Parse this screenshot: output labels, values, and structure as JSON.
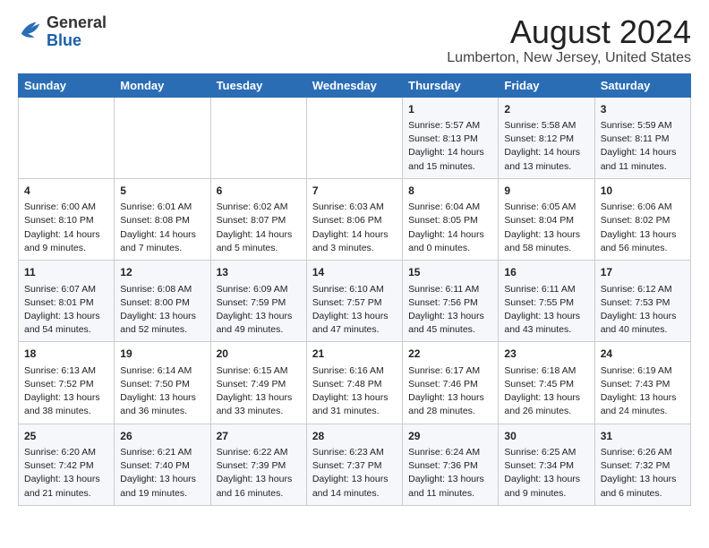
{
  "header": {
    "logo_line1": "General",
    "logo_line2": "Blue",
    "month_title": "August 2024",
    "location": "Lumberton, New Jersey, United States"
  },
  "calendar": {
    "days_of_week": [
      "Sunday",
      "Monday",
      "Tuesday",
      "Wednesday",
      "Thursday",
      "Friday",
      "Saturday"
    ],
    "weeks": [
      [
        {
          "day": "",
          "content": ""
        },
        {
          "day": "",
          "content": ""
        },
        {
          "day": "",
          "content": ""
        },
        {
          "day": "",
          "content": ""
        },
        {
          "day": "1",
          "content": "Sunrise: 5:57 AM\nSunset: 8:13 PM\nDaylight: 14 hours\nand 15 minutes."
        },
        {
          "day": "2",
          "content": "Sunrise: 5:58 AM\nSunset: 8:12 PM\nDaylight: 14 hours\nand 13 minutes."
        },
        {
          "day": "3",
          "content": "Sunrise: 5:59 AM\nSunset: 8:11 PM\nDaylight: 14 hours\nand 11 minutes."
        }
      ],
      [
        {
          "day": "4",
          "content": "Sunrise: 6:00 AM\nSunset: 8:10 PM\nDaylight: 14 hours\nand 9 minutes."
        },
        {
          "day": "5",
          "content": "Sunrise: 6:01 AM\nSunset: 8:08 PM\nDaylight: 14 hours\nand 7 minutes."
        },
        {
          "day": "6",
          "content": "Sunrise: 6:02 AM\nSunset: 8:07 PM\nDaylight: 14 hours\nand 5 minutes."
        },
        {
          "day": "7",
          "content": "Sunrise: 6:03 AM\nSunset: 8:06 PM\nDaylight: 14 hours\nand 3 minutes."
        },
        {
          "day": "8",
          "content": "Sunrise: 6:04 AM\nSunset: 8:05 PM\nDaylight: 14 hours\nand 0 minutes."
        },
        {
          "day": "9",
          "content": "Sunrise: 6:05 AM\nSunset: 8:04 PM\nDaylight: 13 hours\nand 58 minutes."
        },
        {
          "day": "10",
          "content": "Sunrise: 6:06 AM\nSunset: 8:02 PM\nDaylight: 13 hours\nand 56 minutes."
        }
      ],
      [
        {
          "day": "11",
          "content": "Sunrise: 6:07 AM\nSunset: 8:01 PM\nDaylight: 13 hours\nand 54 minutes."
        },
        {
          "day": "12",
          "content": "Sunrise: 6:08 AM\nSunset: 8:00 PM\nDaylight: 13 hours\nand 52 minutes."
        },
        {
          "day": "13",
          "content": "Sunrise: 6:09 AM\nSunset: 7:59 PM\nDaylight: 13 hours\nand 49 minutes."
        },
        {
          "day": "14",
          "content": "Sunrise: 6:10 AM\nSunset: 7:57 PM\nDaylight: 13 hours\nand 47 minutes."
        },
        {
          "day": "15",
          "content": "Sunrise: 6:11 AM\nSunset: 7:56 PM\nDaylight: 13 hours\nand 45 minutes."
        },
        {
          "day": "16",
          "content": "Sunrise: 6:11 AM\nSunset: 7:55 PM\nDaylight: 13 hours\nand 43 minutes."
        },
        {
          "day": "17",
          "content": "Sunrise: 6:12 AM\nSunset: 7:53 PM\nDaylight: 13 hours\nand 40 minutes."
        }
      ],
      [
        {
          "day": "18",
          "content": "Sunrise: 6:13 AM\nSunset: 7:52 PM\nDaylight: 13 hours\nand 38 minutes."
        },
        {
          "day": "19",
          "content": "Sunrise: 6:14 AM\nSunset: 7:50 PM\nDaylight: 13 hours\nand 36 minutes."
        },
        {
          "day": "20",
          "content": "Sunrise: 6:15 AM\nSunset: 7:49 PM\nDaylight: 13 hours\nand 33 minutes."
        },
        {
          "day": "21",
          "content": "Sunrise: 6:16 AM\nSunset: 7:48 PM\nDaylight: 13 hours\nand 31 minutes."
        },
        {
          "day": "22",
          "content": "Sunrise: 6:17 AM\nSunset: 7:46 PM\nDaylight: 13 hours\nand 28 minutes."
        },
        {
          "day": "23",
          "content": "Sunrise: 6:18 AM\nSunset: 7:45 PM\nDaylight: 13 hours\nand 26 minutes."
        },
        {
          "day": "24",
          "content": "Sunrise: 6:19 AM\nSunset: 7:43 PM\nDaylight: 13 hours\nand 24 minutes."
        }
      ],
      [
        {
          "day": "25",
          "content": "Sunrise: 6:20 AM\nSunset: 7:42 PM\nDaylight: 13 hours\nand 21 minutes."
        },
        {
          "day": "26",
          "content": "Sunrise: 6:21 AM\nSunset: 7:40 PM\nDaylight: 13 hours\nand 19 minutes."
        },
        {
          "day": "27",
          "content": "Sunrise: 6:22 AM\nSunset: 7:39 PM\nDaylight: 13 hours\nand 16 minutes."
        },
        {
          "day": "28",
          "content": "Sunrise: 6:23 AM\nSunset: 7:37 PM\nDaylight: 13 hours\nand 14 minutes."
        },
        {
          "day": "29",
          "content": "Sunrise: 6:24 AM\nSunset: 7:36 PM\nDaylight: 13 hours\nand 11 minutes."
        },
        {
          "day": "30",
          "content": "Sunrise: 6:25 AM\nSunset: 7:34 PM\nDaylight: 13 hours\nand 9 minutes."
        },
        {
          "day": "31",
          "content": "Sunrise: 6:26 AM\nSunset: 7:32 PM\nDaylight: 13 hours\nand 6 minutes."
        }
      ]
    ]
  }
}
